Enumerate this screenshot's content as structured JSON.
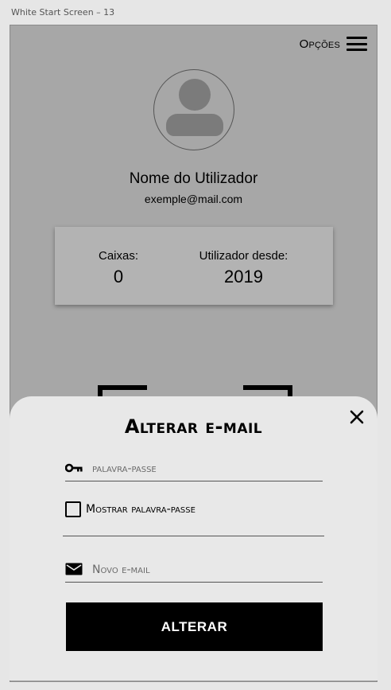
{
  "artboard": {
    "title": "White Start Screen – 13"
  },
  "header": {
    "options_label": "Opções"
  },
  "profile": {
    "name": "Nome do Utilizador",
    "email": "exemple@mail.com"
  },
  "stats": {
    "boxes_label": "Caixas:",
    "boxes_value": "0",
    "since_label": "Utilizador desde:",
    "since_value": "2019"
  },
  "dialog": {
    "title": "Alterar e-mail",
    "password_placeholder": "palavra-passe",
    "show_password_label": "Mostrar palavra-passe",
    "show_password_checked": false,
    "new_email_placeholder": "Novo e-mail",
    "submit_label": "ALTERAR"
  },
  "icons": {
    "menu": "hamburger-icon",
    "avatar": "user-silhouette-icon",
    "close": "close-icon",
    "password": "key-icon",
    "email": "envelope-icon"
  }
}
